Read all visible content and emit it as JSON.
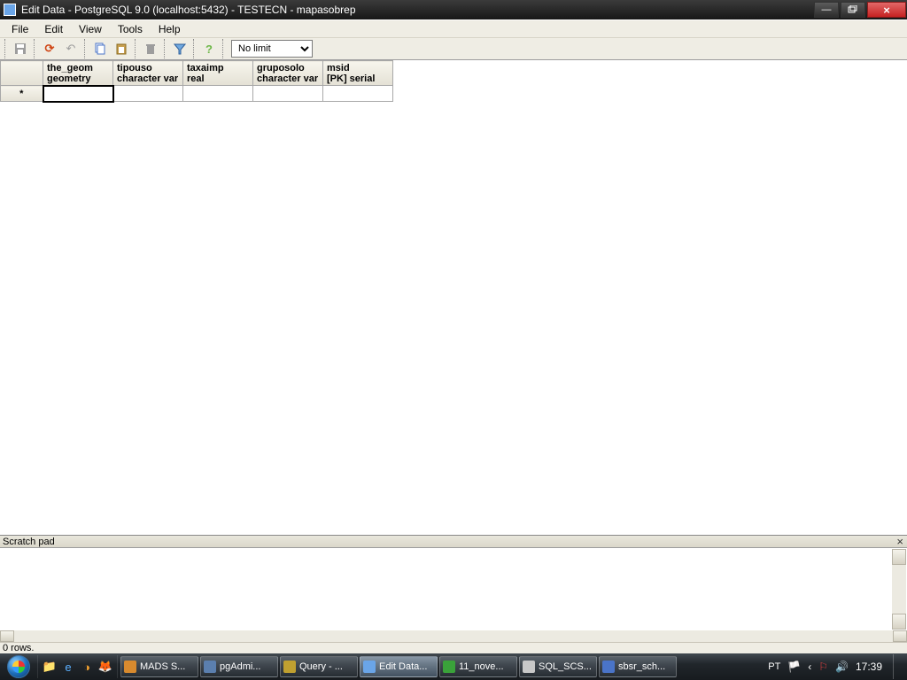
{
  "window": {
    "title": "Edit Data - PostgreSQL 9.0 (localhost:5432) - TESTECN - mapasobrep"
  },
  "menu": {
    "file": "File",
    "edit": "Edit",
    "view": "View",
    "tools": "Tools",
    "help": "Help"
  },
  "toolbar": {
    "limit": "No limit"
  },
  "grid": {
    "columns": [
      {
        "name": "the_geom",
        "type": "geometry"
      },
      {
        "name": "tipouso",
        "type": "character var"
      },
      {
        "name": "taxaimp",
        "type": "real"
      },
      {
        "name": "gruposolo",
        "type": "character var"
      },
      {
        "name": "msid",
        "type": "[PK] serial"
      }
    ],
    "newrow_marker": "*"
  },
  "scratch": {
    "label": "Scratch pad"
  },
  "status": {
    "rows": "0 rows."
  },
  "taskbar": {
    "items": [
      {
        "label": "MADS S...",
        "color": "#d88a2e"
      },
      {
        "label": "pgAdmi...",
        "color": "#5b7fae"
      },
      {
        "label": "Query - ...",
        "color": "#c0a030"
      },
      {
        "label": "Edit Data...",
        "color": "#6aa5e8",
        "active": true
      },
      {
        "label": "11_nove...",
        "color": "#3aa23a"
      },
      {
        "label": "SQL_SCS...",
        "color": "#c8c8c8"
      },
      {
        "label": "sbsr_sch...",
        "color": "#4a74c8"
      }
    ],
    "lang": "PT",
    "clock": "17:39"
  }
}
